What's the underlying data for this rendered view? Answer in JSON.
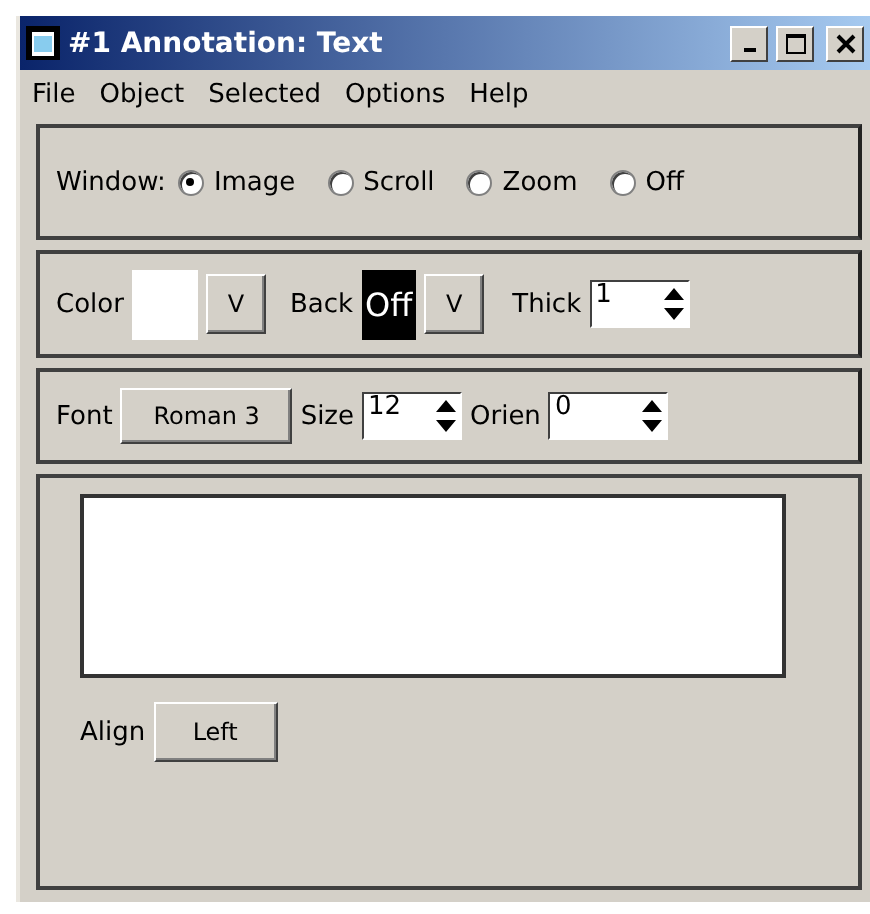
{
  "window": {
    "title": "#1 Annotation: Text"
  },
  "menu": [
    "File",
    "Object",
    "Selected",
    "Options",
    "Help"
  ],
  "window_mode": {
    "label": "Window:",
    "options": [
      {
        "label": "Image",
        "selected": true
      },
      {
        "label": "Scroll",
        "selected": false
      },
      {
        "label": "Zoom",
        "selected": false
      },
      {
        "label": "Off",
        "selected": false
      }
    ]
  },
  "color": {
    "label": "Color",
    "menu_button": "V"
  },
  "back": {
    "label": "Back",
    "value": "Off",
    "menu_button": "V"
  },
  "thick": {
    "label": "Thick",
    "value": "1"
  },
  "font": {
    "label": "Font",
    "value": "Roman 3"
  },
  "size": {
    "label": "Size",
    "value": "12"
  },
  "orien": {
    "label": "Orien",
    "value": "0"
  },
  "align": {
    "label": "Align",
    "value": "Left"
  }
}
